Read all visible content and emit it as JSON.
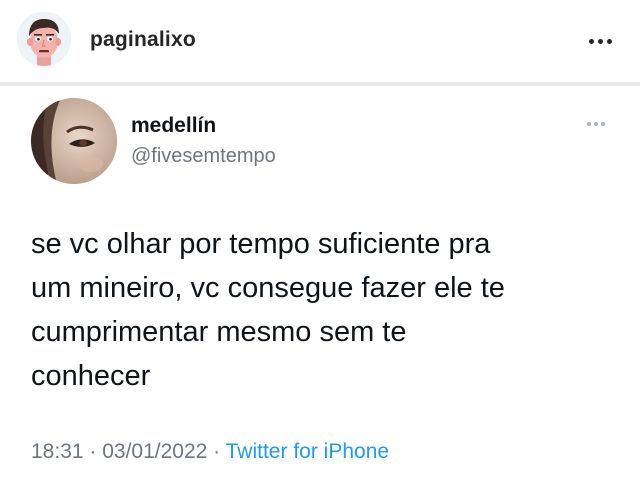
{
  "post": {
    "account": {
      "username": "paginalixo",
      "avatar_icon": "cartoon-face-avatar"
    },
    "more_icon": "more-horizontal-icon"
  },
  "tweet": {
    "author": {
      "name": "medellín",
      "handle": "@fivesemtempo",
      "avatar_icon": "profile-photo-avatar"
    },
    "more_icon": "more-horizontal-icon",
    "text_lines": [
      "se vc olhar por tempo suficiente pra",
      "um mineiro, vc consegue fazer ele te",
      "cumprimentar mesmo sem te",
      "conhecer"
    ],
    "time": "18:31",
    "separator": " · ",
    "date": "03/01/2022",
    "source": "Twitter for iPhone"
  },
  "colors": {
    "text": "#0f1419",
    "secondary": "#6e767d",
    "link": "#1d9bf0",
    "divider": "#e9ebed"
  }
}
